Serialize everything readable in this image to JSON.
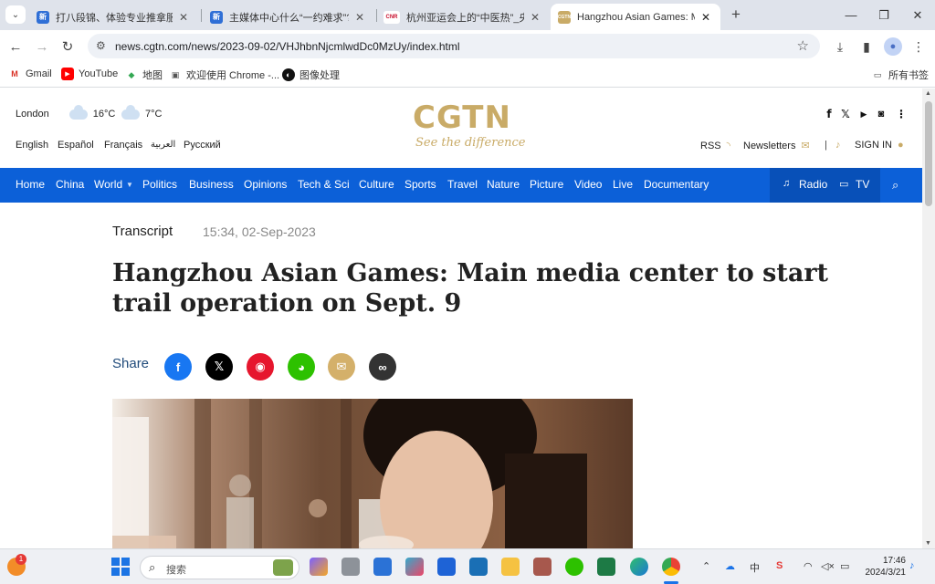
{
  "browser": {
    "tabs": [
      {
        "title": "打八段锦、体验专业推拿服务…",
        "favicon_color": "#2f6fd6",
        "favicon_text": "新"
      },
      {
        "title": "主媒体中心什么“一约难求”? 不",
        "favicon_color": "#2f6fd6",
        "favicon_text": "新"
      },
      {
        "title": "杭州亚运会上的“中医热”_央广网",
        "favicon_color": "#c8102e",
        "favicon_text": "CNR"
      },
      {
        "title": "Hangzhou Asian Games: Main",
        "favicon_color": "#c9ab67",
        "favicon_text": "CGTN"
      }
    ],
    "url": "news.cgtn.com/news/2023-09-02/VHJhbnNjcmlwdDc0MzUy/index.html",
    "bookmarks": [
      "Gmail",
      "YouTube",
      "地图",
      "欢迎使用 Chrome -...",
      "图像处理"
    ],
    "all_bookmarks": "所有书签"
  },
  "site": {
    "weather": [
      {
        "city": "London",
        "temp": "16°C"
      },
      {
        "temp": "7°C"
      }
    ],
    "languages": [
      "English",
      "Español",
      "Français",
      "العربية",
      "Русский"
    ],
    "logo": "CGTN",
    "tagline": "See the difference",
    "rss": "RSS",
    "newsletters": "Newsletters",
    "sign_in": "SIGN IN",
    "nav": [
      "Home",
      "China",
      "World",
      "Politics",
      "Business",
      "Opinions",
      "Tech & Sci",
      "Culture",
      "Sports",
      "Travel",
      "Nature",
      "Picture",
      "Video",
      "Live",
      "Documentary"
    ],
    "radio": "Radio",
    "tv": "TV"
  },
  "article": {
    "category": "Transcript",
    "timestamp": "15:34, 02-Sep-2023",
    "title": "Hangzhou Asian Games: Main media center to start trail operation on Sept. 9",
    "share_label": "Share"
  },
  "taskbar": {
    "search_placeholder": "搜索",
    "ime": "中",
    "time": "17:46",
    "date": "2024/3/21",
    "notification_count": "1"
  }
}
